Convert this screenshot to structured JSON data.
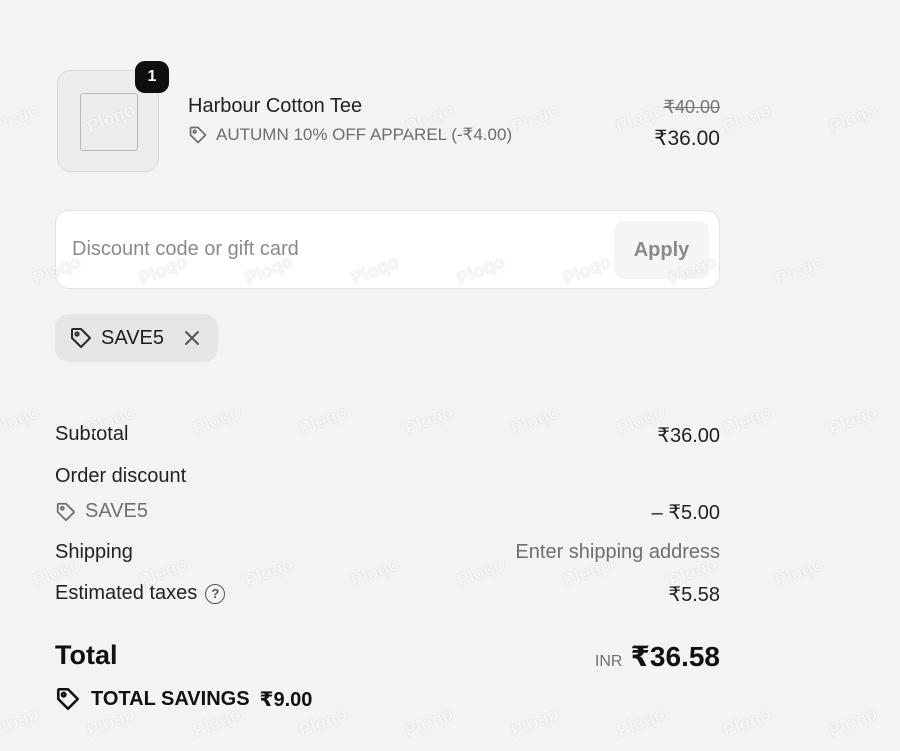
{
  "line_item": {
    "quantity": "1",
    "name": "Harbour Cotton Tee",
    "discount_label": "AUTUMN 10% OFF APPAREL (-₹4.00)",
    "original_price": "₹40.00",
    "price": "₹36.00"
  },
  "discount": {
    "placeholder": "Discount code or gift card",
    "value": "",
    "apply_label": "Apply"
  },
  "applied_code": {
    "label": "SAVE5"
  },
  "summary": {
    "subtotal_label": "Subtotal",
    "subtotal_value": "₹36.00",
    "order_discount_label": "Order discount",
    "order_discount_code": "SAVE5",
    "order_discount_value": "– ₹5.00",
    "shipping_label": "Shipping",
    "shipping_value": "Enter shipping address",
    "taxes_label": "Estimated taxes",
    "taxes_value": "₹5.58",
    "total_label": "Total",
    "total_currency": "INR",
    "total_value": "₹36.58",
    "savings_label": "TOTAL SAVINGS",
    "savings_value": "₹9.00"
  },
  "watermark": "Ploqo",
  "icons": {
    "tag": "tag-icon",
    "close": "close-icon",
    "help": "help-icon"
  },
  "colors": {
    "background": "#f3f3f3",
    "badge": "#0f0f0f",
    "muted_text": "#6f6f6f"
  }
}
